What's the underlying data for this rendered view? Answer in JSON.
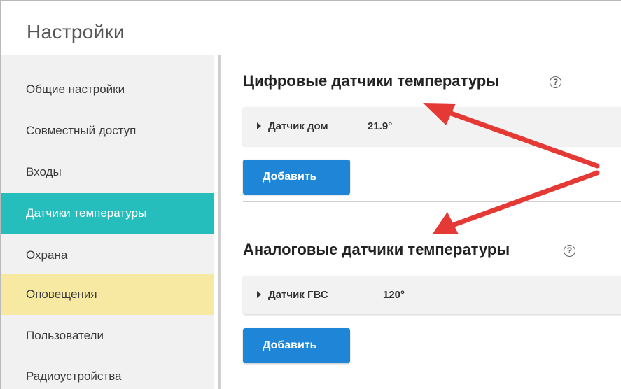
{
  "header": {
    "title": "Настройки"
  },
  "sidebar": {
    "items": [
      {
        "label": "Общие настройки",
        "state": "normal"
      },
      {
        "label": "Совместный доступ",
        "state": "normal"
      },
      {
        "label": "Входы",
        "state": "normal"
      },
      {
        "label": "Датчики температуры",
        "state": "active"
      },
      {
        "label": "Охрана",
        "state": "normal"
      },
      {
        "label": "Оповещения",
        "state": "highlighted"
      },
      {
        "label": "Пользователи",
        "state": "normal"
      },
      {
        "label": "Радиоустройства",
        "state": "normal"
      }
    ]
  },
  "digital": {
    "title": "Цифровые датчики температуры",
    "help": "?",
    "sensors": [
      {
        "name": "Датчик дом",
        "value": "21.9°"
      }
    ],
    "add_label": "Добавить"
  },
  "analog": {
    "title": "Аналоговые датчики температуры",
    "help": "?",
    "sensors": [
      {
        "name": "Датчик ГВС",
        "value": "120°"
      }
    ],
    "add_label": "Добавить"
  },
  "colors": {
    "active_item": "#26bdbd",
    "highlight_item": "#f7e8a2",
    "button": "#1f85d6",
    "arrow": "#e53935"
  }
}
